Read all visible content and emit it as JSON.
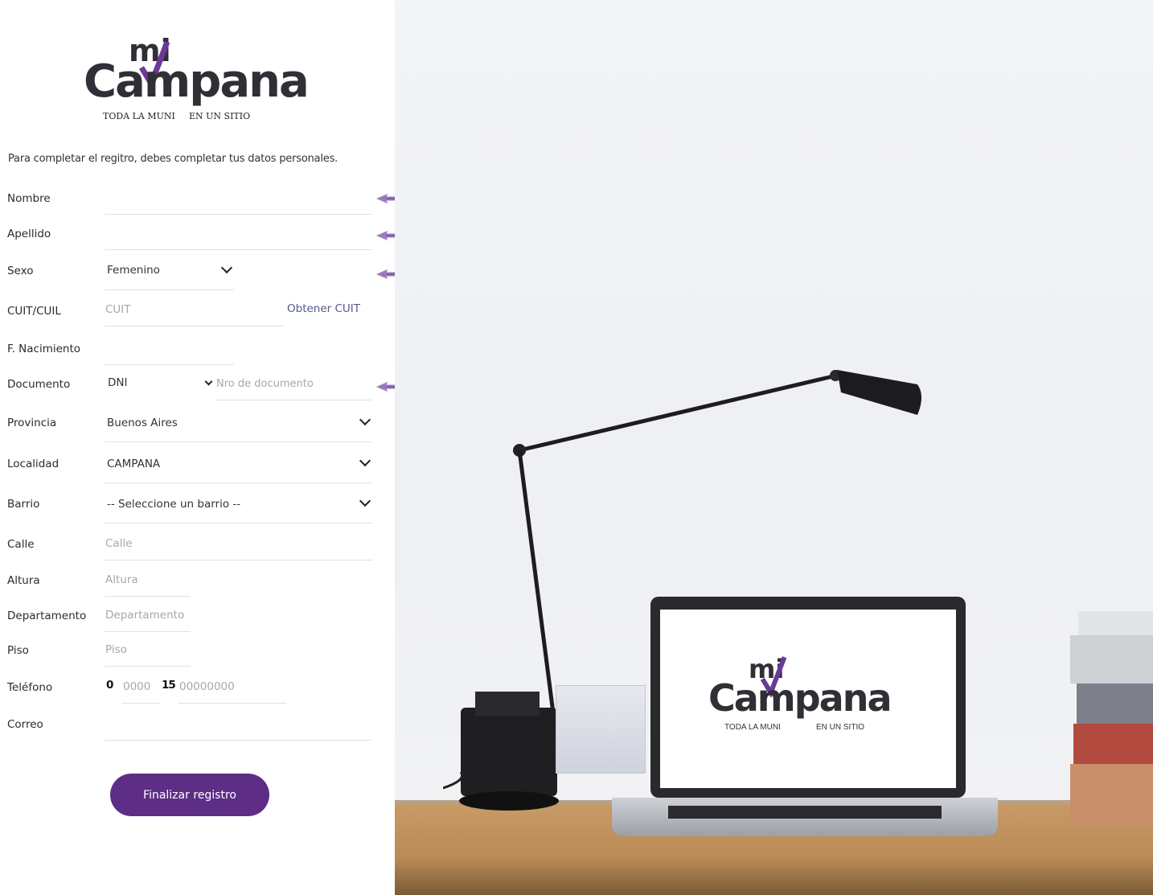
{
  "logo": {
    "mi": "mi",
    "word": "Campana",
    "tagline_left": "TODA LA MUNI",
    "tagline_right": "EN UN SITIO"
  },
  "intro": "Para completar el regitro, debes completar tus datos personales.",
  "form": {
    "nombre": {
      "label": "Nombre",
      "value": ""
    },
    "apellido": {
      "label": "Apellido",
      "value": ""
    },
    "sexo": {
      "label": "Sexo",
      "value": "Femenino"
    },
    "cuit": {
      "label": "CUIT/CUIL",
      "placeholder": "CUIT",
      "link": "Obtener CUIT"
    },
    "nacimiento": {
      "label": "F. Nacimiento",
      "value": ""
    },
    "documento": {
      "label": "Documento",
      "type": "DNI",
      "placeholder": "Nro de documento"
    },
    "provincia": {
      "label": "Provincia",
      "value": "Buenos Aires"
    },
    "localidad": {
      "label": "Localidad",
      "value": "CAMPANA"
    },
    "barrio": {
      "label": "Barrio",
      "value": "-- Seleccione un barrio --"
    },
    "calle": {
      "label": "Calle",
      "placeholder": "Calle"
    },
    "altura": {
      "label": "Altura",
      "placeholder": "Altura"
    },
    "departamento": {
      "label": "Departamento",
      "placeholder": "Departamento"
    },
    "piso": {
      "label": "Piso",
      "placeholder": "Piso"
    },
    "telefono": {
      "label": "Teléfono",
      "prefix": "0",
      "area_placeholder": "0000",
      "mobile_prefix": "15",
      "number_placeholder": "00000000"
    },
    "correo": {
      "label": "Correo",
      "value": ""
    }
  },
  "submit_label": "Finalizar registro",
  "colors": {
    "brand": "#5e2d86",
    "arrow": "#9b7bbf"
  },
  "laptop_logo": {
    "mi": "mi",
    "word": "Campana",
    "tagline_left": "TODA LA MUNI",
    "tagline_right": "EN UN SITIO"
  }
}
